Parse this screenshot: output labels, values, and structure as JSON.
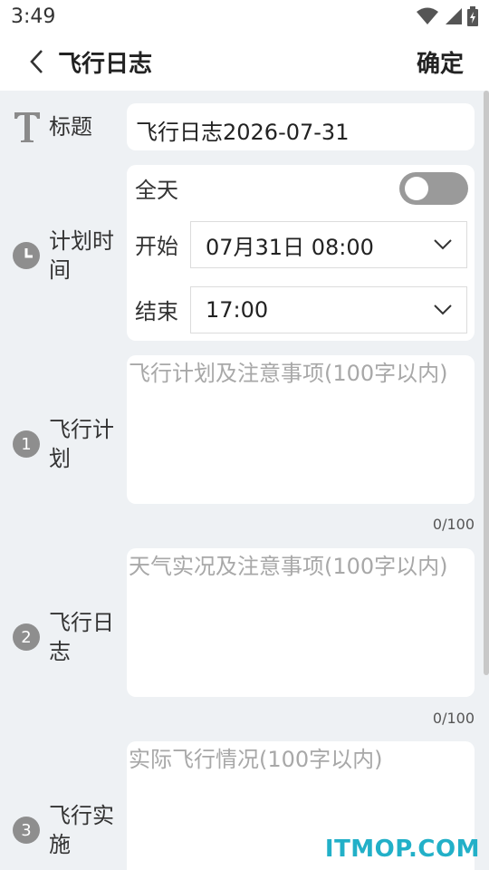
{
  "status_bar": {
    "time": "3:49"
  },
  "header": {
    "title": "飞行日志",
    "confirm": "确定"
  },
  "title_field": {
    "label": "标题",
    "value": "飞行日志2026-07-31"
  },
  "plan_time": {
    "label_line1": "计划时",
    "label_line2": "间",
    "all_day_label": "全天",
    "all_day_on": false,
    "start_label": "开始",
    "start_value": "07月31日 08:00",
    "end_label": "结束",
    "end_value": "17:00"
  },
  "sections": [
    {
      "num": "1",
      "label_line1": "飞行计",
      "label_line2": "划",
      "placeholder": "飞行计划及注意事项(100字以内)",
      "counter": "0/100"
    },
    {
      "num": "2",
      "label_line1": "飞行日",
      "label_line2": "志",
      "placeholder": "天气实况及注意事项(100字以内)",
      "counter": "0/100"
    },
    {
      "num": "3",
      "label_line1": "飞行实",
      "label_line2": "施",
      "placeholder": "实际飞行情况(100字以内)"
    }
  ],
  "watermark": "ITMOP.COM"
}
